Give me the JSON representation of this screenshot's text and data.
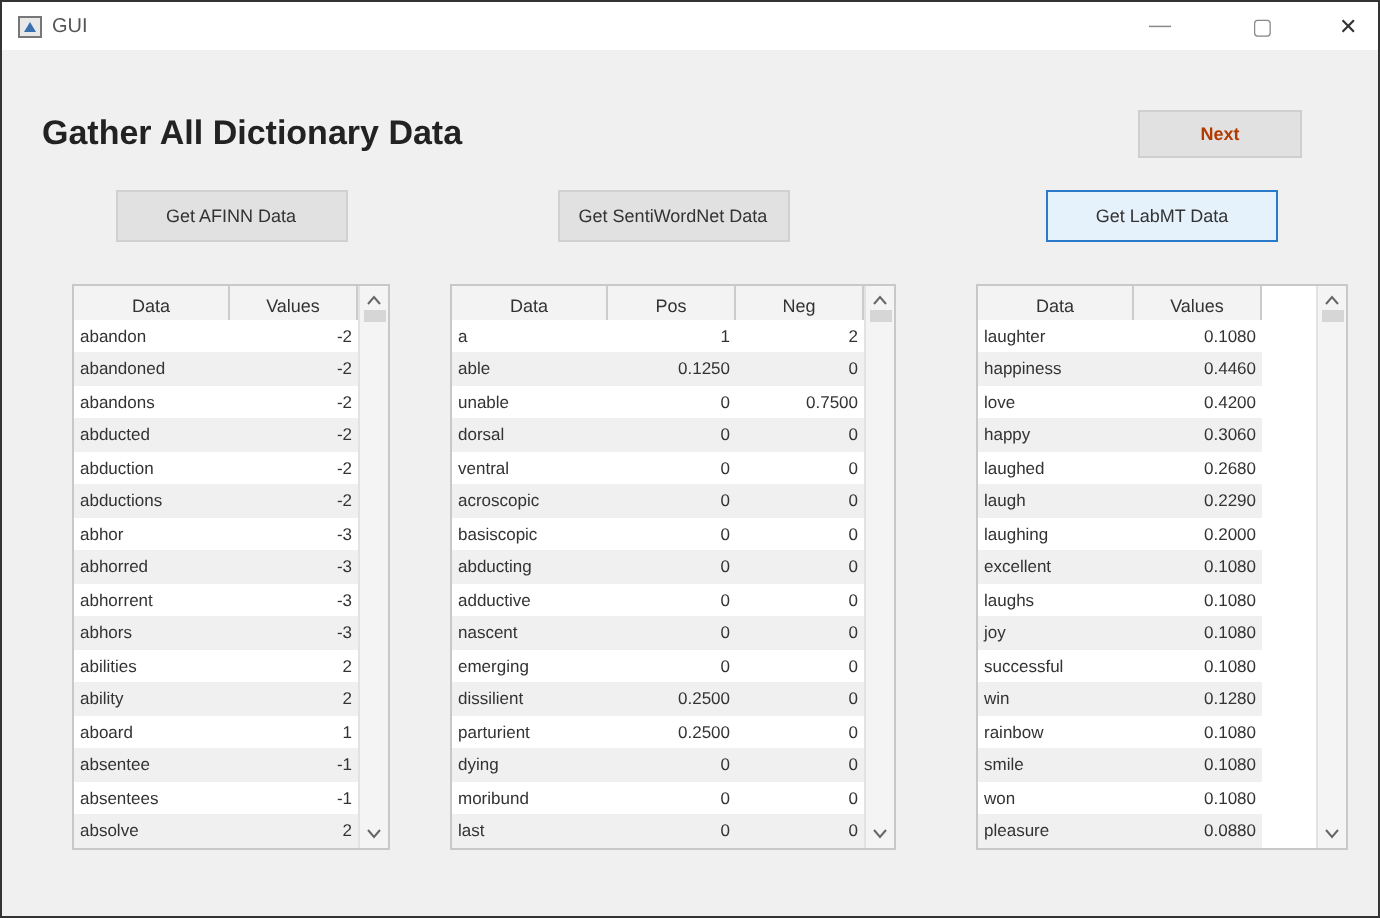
{
  "window": {
    "title": "GUI",
    "controls": [
      "—",
      "▢",
      "✕"
    ]
  },
  "heading": "Gather All Dictionary Data",
  "next_button": {
    "label": "Next"
  },
  "panels": [
    {
      "button": {
        "label": "Get AFINN Data",
        "focused": false
      },
      "columns": [
        "Data",
        "Values"
      ],
      "rows": [
        [
          "abandon",
          "-2"
        ],
        [
          "abandoned",
          "-2"
        ],
        [
          "abandons",
          "-2"
        ],
        [
          "abducted",
          "-2"
        ],
        [
          "abduction",
          "-2"
        ],
        [
          "abductions",
          "-2"
        ],
        [
          "abhor",
          "-3"
        ],
        [
          "abhorred",
          "-3"
        ],
        [
          "abhorrent",
          "-3"
        ],
        [
          "abhors",
          "-3"
        ],
        [
          "abilities",
          "2"
        ],
        [
          "ability",
          "2"
        ],
        [
          "aboard",
          "1"
        ],
        [
          "absentee",
          "-1"
        ],
        [
          "absentees",
          "-1"
        ],
        [
          "absolve",
          "2"
        ]
      ]
    },
    {
      "button": {
        "label": "Get SentiWordNet Data",
        "focused": false
      },
      "columns": [
        "Data",
        "Pos",
        "Neg"
      ],
      "rows": [
        [
          "a",
          "1",
          "2"
        ],
        [
          "able",
          "0.1250",
          "0"
        ],
        [
          "unable",
          "0",
          "0.7500"
        ],
        [
          "dorsal",
          "0",
          "0"
        ],
        [
          "ventral",
          "0",
          "0"
        ],
        [
          "acroscopic",
          "0",
          "0"
        ],
        [
          "basiscopic",
          "0",
          "0"
        ],
        [
          "abducting",
          "0",
          "0"
        ],
        [
          "adductive",
          "0",
          "0"
        ],
        [
          "nascent",
          "0",
          "0"
        ],
        [
          "emerging",
          "0",
          "0"
        ],
        [
          "dissilient",
          "0.2500",
          "0"
        ],
        [
          "parturient",
          "0.2500",
          "0"
        ],
        [
          "dying",
          "0",
          "0"
        ],
        [
          "moribund",
          "0",
          "0"
        ],
        [
          "last",
          "0",
          "0"
        ]
      ]
    },
    {
      "button": {
        "label": "Get LabMT Data",
        "focused": true
      },
      "columns": [
        "Data",
        "Values"
      ],
      "rows": [
        [
          "laughter",
          "0.1080"
        ],
        [
          "happiness",
          "0.4460"
        ],
        [
          "love",
          "0.4200"
        ],
        [
          "happy",
          "0.3060"
        ],
        [
          "laughed",
          "0.2680"
        ],
        [
          "laugh",
          "0.2290"
        ],
        [
          "laughing",
          "0.2000"
        ],
        [
          "excellent",
          "0.1080"
        ],
        [
          "laughs",
          "0.1080"
        ],
        [
          "joy",
          "0.1080"
        ],
        [
          "successful",
          "0.1080"
        ],
        [
          "win",
          "0.1280"
        ],
        [
          "rainbow",
          "0.1080"
        ],
        [
          "smile",
          "0.1080"
        ],
        [
          "won",
          "0.1080"
        ],
        [
          "pleasure",
          "0.0880"
        ]
      ]
    }
  ]
}
